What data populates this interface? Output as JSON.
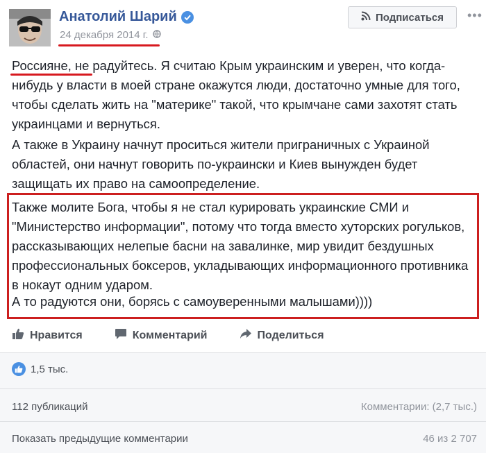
{
  "post": {
    "author": "Анатолий Шарий",
    "date": "24 декабря 2014 г.",
    "subscribe_label": "Подписаться",
    "paragraphs": [
      "Россияне, не радуйтесь. Я считаю Крым украинским и уверен, что когда-нибудь у власти в моей стране окажутся люди, достаточно умные для того, чтобы сделать жить на \"материке\" такой, что крымчане сами захотят стать украинцами и вернуться.",
      "А также в Украину начнут проситься жители приграничных с Украиной областей, они начнут говорить по-украински и Киев вынужден будет защищать их право на самоопределение.",
      "Также молите Бога, чтобы я не стал курировать украинские СМИ и \"Министерство информации\", потому что тогда вместо хуторских рогульков, рассказывающих нелепые басни на завалинке, мир увидит бездушных профессиональных боксеров, укладывающих информационного противника в нокаут одним ударом.",
      "А то радуются они, борясь с самоуверенными малышами))))"
    ]
  },
  "actions": {
    "like": "Нравится",
    "comment": "Комментарий",
    "share": "Поделиться"
  },
  "stats": {
    "reactions": "1,5 тыс.",
    "shares": "112 публикаций",
    "comments": "Комментарии: (2,7 тыс.)",
    "show_previous": "Показать предыдущие комментарии",
    "comment_count": "46 из 2 707"
  },
  "icons": {
    "verified": "verified-badge-icon",
    "globe": "globe-icon",
    "rss": "rss-icon",
    "more": "more-icon",
    "like": "thumbs-up-icon",
    "comment": "speech-bubble-icon",
    "share": "share-arrow-icon"
  },
  "colors": {
    "author_link": "#365899",
    "text": "#1d2129",
    "muted": "#90949c",
    "annotation_red": "#d7191f",
    "like_blue": "#4a90e2"
  }
}
